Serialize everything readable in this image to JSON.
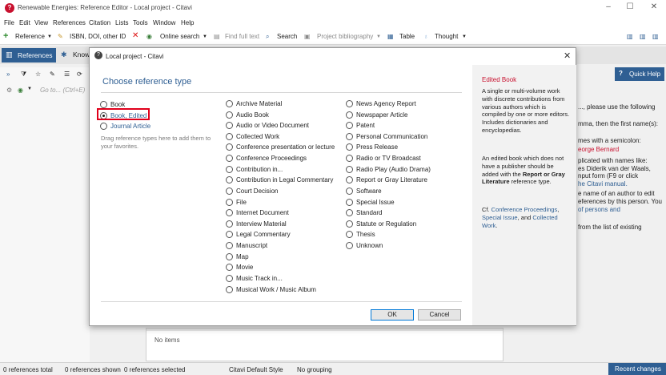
{
  "app": {
    "title": "Renewable Energies: Reference Editor - Local project - Citavi",
    "logo_letter": "?",
    "window_controls": [
      "–",
      "☐",
      "✕"
    ]
  },
  "menu": [
    "File",
    "Edit",
    "View",
    "References",
    "Citation",
    "Lists",
    "Tools",
    "Window",
    "Help"
  ],
  "toolbar": {
    "reference": "Reference",
    "isbn": "ISBN, DOI, other ID",
    "online_search": "Online search",
    "find_full_text": "Find full text",
    "search": "Search",
    "project_bibliography": "Project bibliography",
    "table": "Table",
    "thought": "Thought"
  },
  "tabs": {
    "references": "References",
    "knowledge": "Know"
  },
  "goto_placeholder": "Go to... (Ctrl+E)",
  "quick_help": "Quick Help",
  "background_help": [
    "..., please use the following",
    "mma, then the first name(s):",
    "mes with a semicolon:",
    "eorge Bernard",
    "plicated with names like:",
    "es Diderik van der Waals,",
    "nput form (F9 or click",
    "he Citavi manual.",
    "e name of an author to edit",
    "eferences by this person. You",
    "of persons and",
    "from the list of existing"
  ],
  "background_list": {
    "no_items": "No items"
  },
  "statusbar": {
    "total": "0 references total",
    "shown": "0 references shown",
    "selected": "0 references selected",
    "style": "Citavi Default Style",
    "grouping": "No grouping",
    "recent": "Recent changes"
  },
  "dialog": {
    "title": "Local project - Citavi",
    "close": "✕",
    "heading": "Choose reference type",
    "col1": [
      "Book",
      "Book, Edited",
      "Journal Article"
    ],
    "selected": "Book, Edited",
    "hint": "Drag reference types here to add them to your favorites.",
    "col2": [
      "Archive Material",
      "Audio Book",
      "Audio or Video Document",
      "Collected Work",
      "Conference presentation or lecture",
      "Conference Proceedings",
      "Contribution in...",
      "Contribution in Legal Commentary",
      "Court Decision",
      "File",
      "Internet Document",
      "Interview Material",
      "Legal Commentary",
      "Manuscript",
      "Map",
      "Movie",
      "Music Track in...",
      "Musical Work / Music Album"
    ],
    "col3": [
      "News Agency Report",
      "Newspaper Article",
      "Patent",
      "Personal Communication",
      "Press Release",
      "Radio or TV Broadcast",
      "Radio Play (Audio Drama)",
      "Report or Gray Literature",
      "Software",
      "Special Issue",
      "Standard",
      "Statute or Regulation",
      "Thesis",
      "Unknown"
    ],
    "ok": "OK",
    "cancel": "Cancel",
    "info": {
      "title": "Edited Book",
      "p1": "A single or multi-volume work with discrete contributions from various authors which is compiled by one or more editors. Includes dictionaries and encyclopedias.",
      "p2_a": "An edited book which does not have a publisher should be added with the ",
      "p2_b": "Report or Gray Literature",
      "p2_c": " reference type.",
      "p3_a": "Cf. ",
      "p3_l1": "Conference Proceedings",
      "p3_sep": ", ",
      "p3_l2": "Special Issue",
      "p3_mid": ", and ",
      "p3_l3": "Collected Work",
      "p3_end": "."
    }
  },
  "colors": {
    "accent": "#2f5f93",
    "highlight": "#e0001b",
    "info_title": "#c8102e"
  }
}
